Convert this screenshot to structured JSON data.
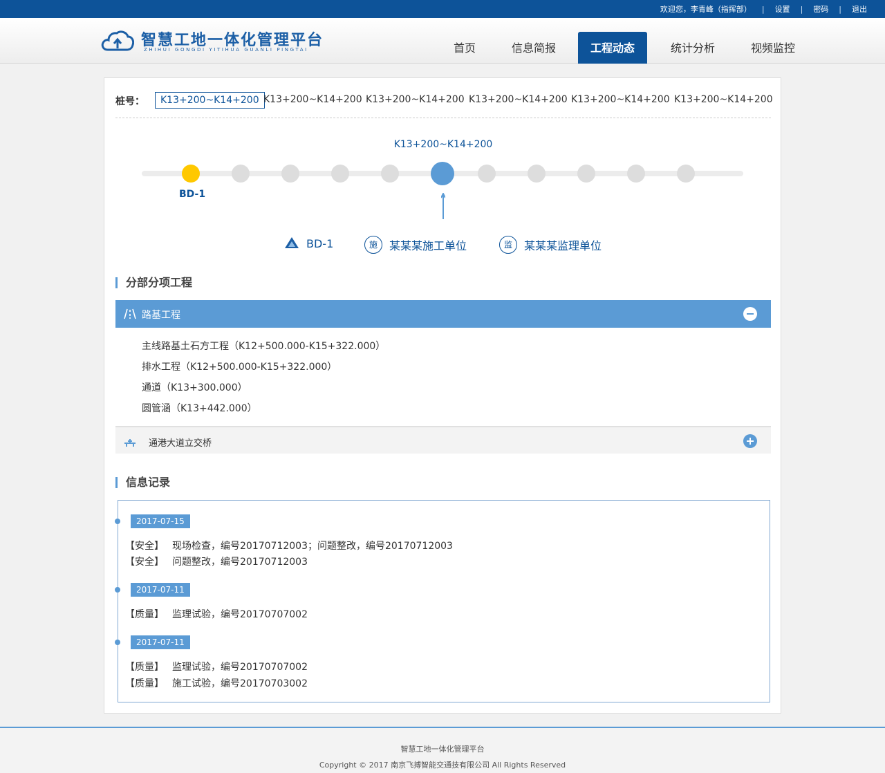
{
  "topbar": {
    "welcome": "欢迎您，李青峰（指挥部）",
    "settings": "设置",
    "password": "密码",
    "logout": "退出",
    "separator": "|"
  },
  "header": {
    "title_cn": "智慧工地一体化管理平台",
    "title_en": "ZHIHUI GONGDI YITIHUA GUANLI PINGTAI",
    "nav": [
      {
        "label": "首页",
        "active": false
      },
      {
        "label": "信息简报",
        "active": false
      },
      {
        "label": "工程动态",
        "active": true
      },
      {
        "label": "统计分析",
        "active": false
      },
      {
        "label": "视频监控",
        "active": false
      }
    ]
  },
  "stakes": {
    "label": "桩号：",
    "items": [
      {
        "label": "K13+200~K14+200",
        "active": true
      },
      {
        "label": "K13+200~K14+200",
        "active": false
      },
      {
        "label": "K13+200~K14+200",
        "active": false
      },
      {
        "label": "K13+200~K14+200",
        "active": false
      },
      {
        "label": "K13+200~K14+200",
        "active": false
      },
      {
        "label": "K13+200~K14+200",
        "active": false
      }
    ]
  },
  "timeline": {
    "current_label": "K13+200~K14+200",
    "start_label": "BD-1",
    "node_count": 11,
    "current_index": 5
  },
  "units": {
    "section": "BD-1",
    "builder_badge": "施",
    "builder": "某某某施工单位",
    "supervisor_badge": "监",
    "supervisor": "某某某监理单位"
  },
  "subprojects": {
    "title": "分部分项工程",
    "groups": [
      {
        "label": "路基工程",
        "icon": "road-icon",
        "expanded": true,
        "items": [
          "主线路基土石方工程（K12+500.000-K15+322.000）",
          "排水工程（K12+500.000-K15+322.000）",
          "通道（K13+300.000）",
          "圆管涵（K13+442.000）"
        ]
      },
      {
        "label": "通港大道立交桥",
        "icon": "bridge-icon",
        "expanded": false,
        "items": []
      }
    ]
  },
  "records": {
    "title": "信息记录",
    "entries": [
      {
        "date": "2017-07-15",
        "lines": [
          {
            "tag": "【安全】",
            "text": "现场检查，编号20170712003；问题整改，编号20170712003"
          },
          {
            "tag": "【安全】",
            "text": "问题整改，编号20170712003"
          }
        ]
      },
      {
        "date": "2017-07-11",
        "lines": [
          {
            "tag": "【质量】",
            "text": "监理试验，编号20170707002"
          }
        ]
      },
      {
        "date": "2017-07-11",
        "lines": [
          {
            "tag": "【质量】",
            "text": "监理试验，编号20170707002"
          },
          {
            "tag": "【质量】",
            "text": "施工试验，编号20170703002"
          }
        ]
      }
    ]
  },
  "footer": {
    "name": "智慧工地一体化管理平台",
    "copyright": "Copyright © 2017 南京飞搏智能交通技有限公司 All Rights Reserved"
  },
  "colors": {
    "primary": "#0d5399",
    "accent": "#5b9bd5",
    "yellow": "#ffc800",
    "node_gray": "#dddddd"
  }
}
